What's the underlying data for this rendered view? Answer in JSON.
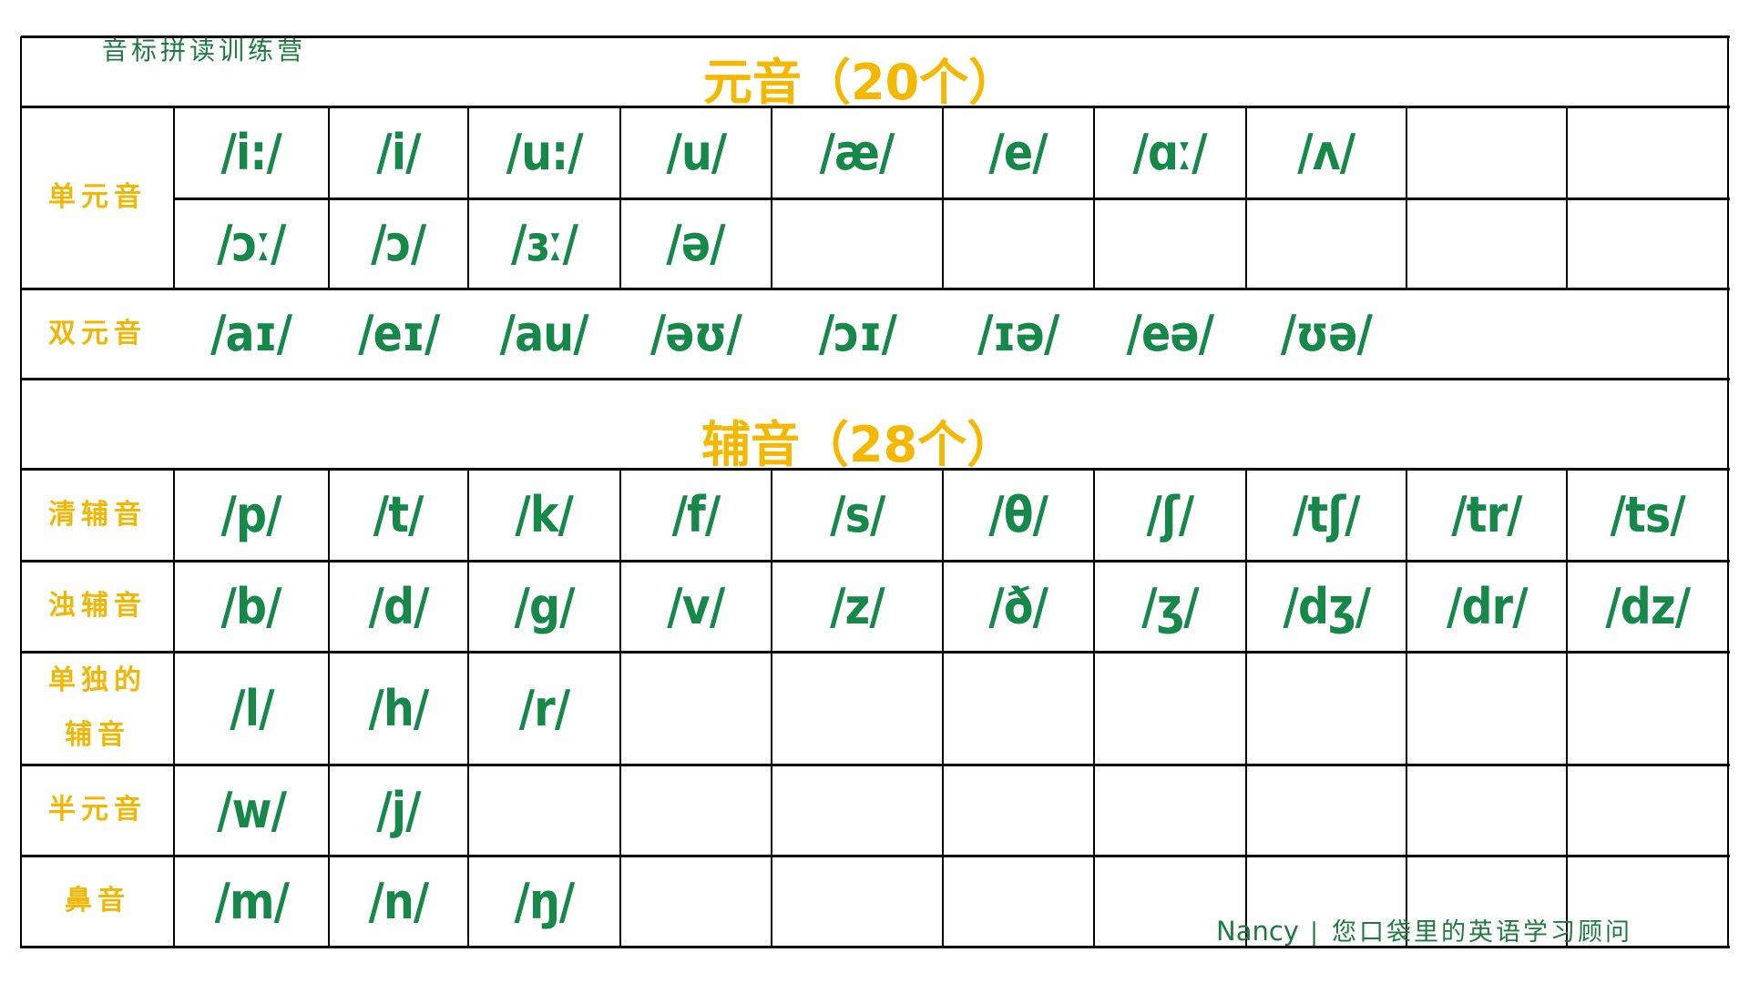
{
  "brand": "音标拼读训练营",
  "vowels": {
    "title": "元音（20个）",
    "monophthongs": {
      "label": "单元音",
      "row1": [
        "/i:/",
        "/i/",
        "/u:/",
        "/u/",
        "/æ/",
        "/e/",
        "/ɑː/",
        "/ʌ/",
        "",
        ""
      ],
      "row2": [
        "/ɔː/",
        "/ɔ/",
        "/ɜː/",
        "/ə/",
        "",
        "",
        "",
        "",
        "",
        ""
      ]
    },
    "diphthongs": {
      "label": "双元音",
      "row": [
        "/aɪ/",
        "/eɪ/",
        "/au/",
        "/əʊ/",
        "/ɔɪ/",
        "/ɪə/",
        "/eə/",
        "/ʊə/",
        "",
        ""
      ]
    }
  },
  "consonants": {
    "title": "辅音（28个）",
    "rows": [
      {
        "label": "清辅音",
        "cells": [
          "/p/",
          "/t/",
          "/k/",
          "/f/",
          "/s/",
          "/θ/",
          "/ʃ/",
          "/tʃ/",
          "/tr/",
          "/ts/"
        ]
      },
      {
        "label": "浊辅音",
        "cells": [
          "/b/",
          "/d/",
          "/g/",
          "/v/",
          "/z/",
          "/ð/",
          "/ʒ/",
          "/dʒ/",
          "/dr/",
          "/dz/"
        ]
      },
      {
        "label": "单独的辅音",
        "label_lines": [
          "单独的",
          "辅音"
        ],
        "cells": [
          "/l/",
          "/h/",
          "/r/",
          "",
          "",
          "",
          "",
          "",
          "",
          ""
        ]
      },
      {
        "label": "半元音",
        "cells": [
          "/w/",
          "/j/",
          "",
          "",
          "",
          "",
          "",
          "",
          "",
          ""
        ]
      },
      {
        "label": "鼻音",
        "cells": [
          "/m/",
          "/n/",
          "/ŋ/",
          "",
          "",
          "",
          "",
          "",
          "",
          ""
        ]
      }
    ]
  },
  "footer": {
    "name": "Nancy",
    "separator": "|",
    "tagline": "您口袋里的英语学习顾问"
  },
  "colors": {
    "phonetic_green": "#15884a",
    "heading_yellow": "#f5b800",
    "brand_green": "#1e7a3e",
    "grid_black": "#000000"
  }
}
